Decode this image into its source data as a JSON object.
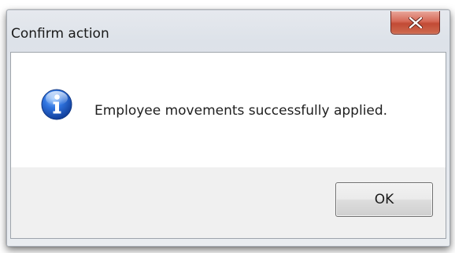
{
  "dialog": {
    "title": "Confirm action",
    "message": "Employee movements successfully applied.",
    "icon": "information-icon",
    "close_icon": "close-icon",
    "ok_label": "OK"
  },
  "colors": {
    "close_button": "#c94f3b",
    "info_icon": "#1f5fd1",
    "content_background": "#ffffff",
    "button_area_background": "#f0f0f0"
  }
}
